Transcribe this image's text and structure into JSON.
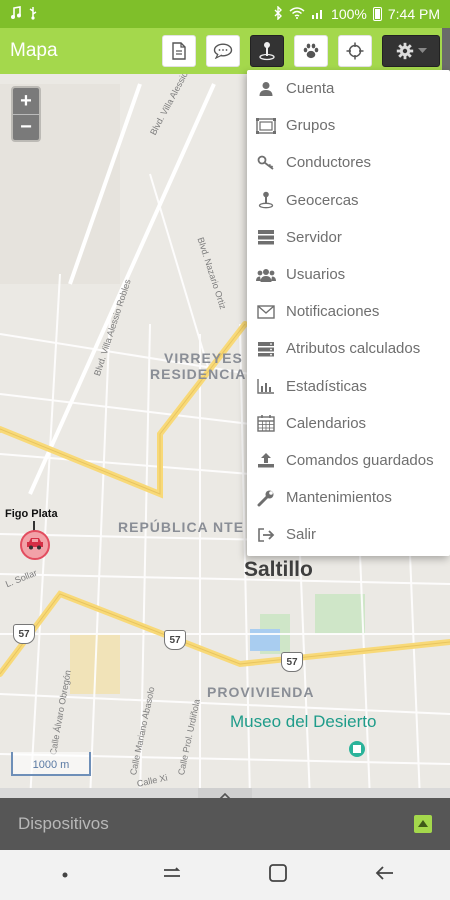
{
  "status_bar": {
    "battery": "100%",
    "time": "7:44 PM"
  },
  "toolbar": {
    "title": "Mapa",
    "buttons": [
      "report-icon",
      "chat-icon",
      "geofence-icon",
      "paw-icon",
      "crosshair-icon",
      "gear-icon"
    ]
  },
  "map": {
    "zoom_in": "+",
    "zoom_out": "−",
    "neighborhoods": [
      "VIRREYES",
      "RESIDENCIA",
      "REPÚBLICA NTE",
      "PROVIVIENDA"
    ],
    "city": "Saltillo",
    "poi": "Museo del Desierto",
    "streets": [
      "Blvd. Villa Alessio Robles",
      "Blvd. Villa Alessio Robles",
      "Blvd. Nazario Ortiz",
      "Calle Álvaro Obregón",
      "Calle Mariano Abasolo",
      "Calle Prol. Urdiñola",
      "L. Sollar",
      "Calle Xi"
    ],
    "shields": [
      "57",
      "57",
      "57"
    ],
    "scale": "1000 m",
    "device_name": "Figo Plata"
  },
  "menu": {
    "items": [
      {
        "label": "Cuenta",
        "icon": "user-icon"
      },
      {
        "label": "Grupos",
        "icon": "groups-icon"
      },
      {
        "label": "Conductores",
        "icon": "key-icon"
      },
      {
        "label": "Geocercas",
        "icon": "geofence-icon"
      },
      {
        "label": "Servidor",
        "icon": "server-icon"
      },
      {
        "label": "Usuarios",
        "icon": "users-icon"
      },
      {
        "label": "Notificaciones",
        "icon": "envelope-icon"
      },
      {
        "label": "Atributos calculados",
        "icon": "storage-icon"
      },
      {
        "label": "Estadísticas",
        "icon": "bar-chart-icon"
      },
      {
        "label": "Calendarios",
        "icon": "calendar-icon"
      },
      {
        "label": "Comandos guardados",
        "icon": "upload-icon"
      },
      {
        "label": "Mantenimientos",
        "icon": "wrench-icon"
      },
      {
        "label": "Salir",
        "icon": "sign-out-icon"
      }
    ]
  },
  "bottom_panel": {
    "title": "Dispositivos"
  },
  "colors": {
    "status_bar": "#7fbf2a",
    "toolbar": "#a4d84c",
    "panel": "#565656"
  }
}
